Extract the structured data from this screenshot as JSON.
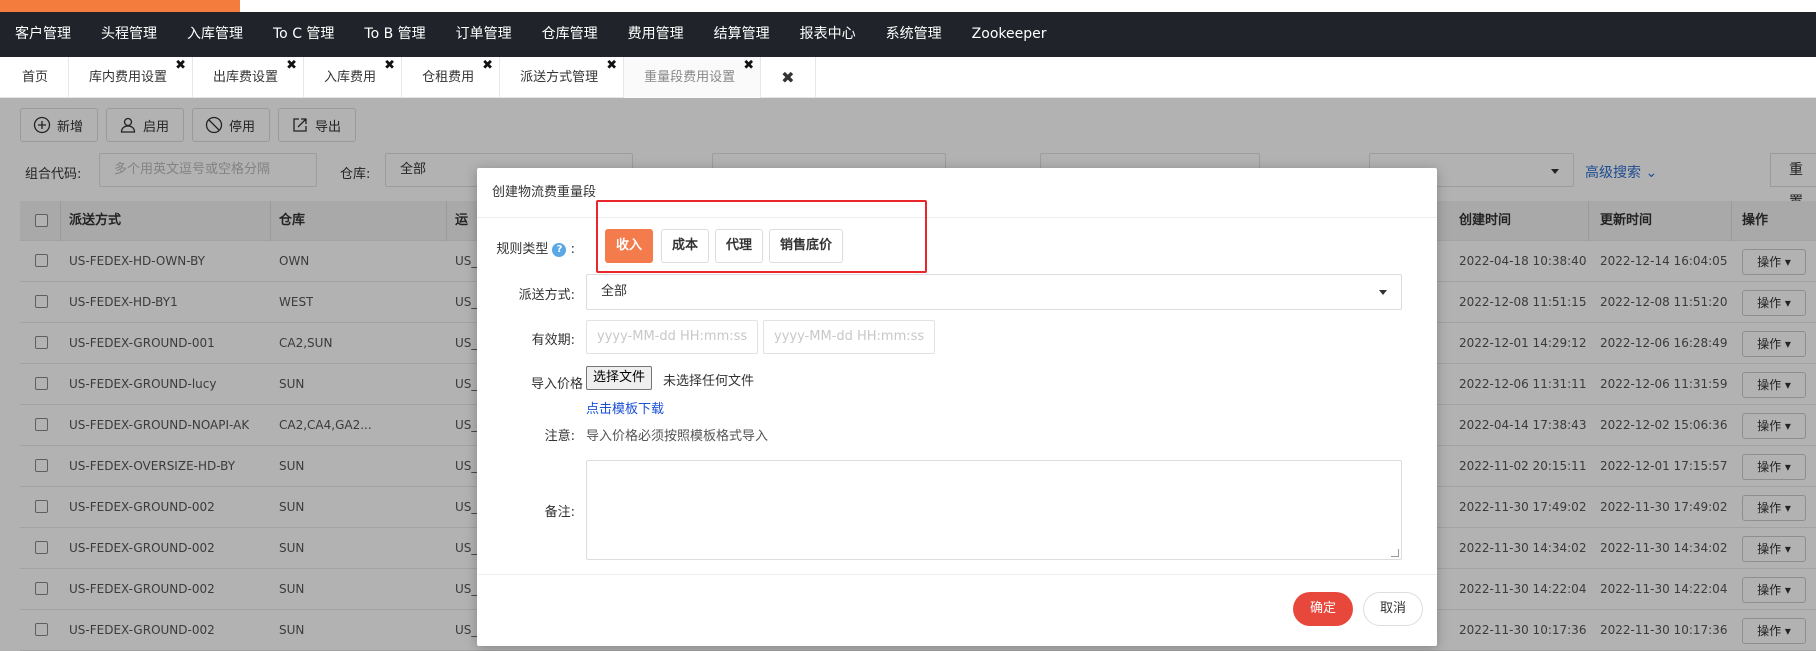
{
  "nav": [
    "客户管理",
    "头程管理",
    "入库管理",
    "To C 管理",
    "To B 管理",
    "订单管理",
    "仓库管理",
    "费用管理",
    "结算管理",
    "报表中心",
    "系统管理",
    "Zookeeper"
  ],
  "tabs": [
    "首页",
    "库内费用设置",
    "出库费设置",
    "入库费用",
    "仓租费用",
    "派送方式管理",
    "重量段费用设置"
  ],
  "tab_close_glyph": "✖",
  "toolbar": {
    "add": "新增",
    "enable": "启用",
    "disable": "停用",
    "export": "导出"
  },
  "filters": {
    "combo_label": "组合代码:",
    "combo_placeholder": "多个用英文逗号或空格分隔",
    "warehouse_label": "仓库:",
    "warehouse_value": "全部",
    "advanced": "高级搜索",
    "reset": "重置"
  },
  "table": {
    "headers": {
      "method": "派送方式",
      "warehouse": "仓库",
      "third": "运",
      "created": "创建时间",
      "updated": "更新时间",
      "op": "操作"
    },
    "op_label": "操作",
    "rows": [
      {
        "method": "US-FEDEX-HD-OWN-BY",
        "warehouse": "OWN",
        "third": "US_",
        "created": "2022-04-18 10:38:40",
        "updated": "2022-12-14 16:04:05"
      },
      {
        "method": "US-FEDEX-HD-BY1",
        "warehouse": "WEST",
        "third": "US_",
        "created": "2022-12-08 11:51:15",
        "updated": "2022-12-08 11:51:20"
      },
      {
        "method": "US-FEDEX-GROUND-001",
        "warehouse": "CA2,SUN",
        "third": "US_",
        "created": "2022-12-01 14:29:12",
        "updated": "2022-12-06 16:28:49"
      },
      {
        "method": "US-FEDEX-GROUND-lucy",
        "warehouse": "SUN",
        "third": "US_",
        "created": "2022-12-06 11:31:11",
        "updated": "2022-12-06 11:31:59"
      },
      {
        "method": "US-FEDEX-GROUND-NOAPI-AK",
        "warehouse": "CA2,CA4,GA2...",
        "third": "US_",
        "created": "2022-04-14 17:38:43",
        "updated": "2022-12-02 15:06:36"
      },
      {
        "method": "US-FEDEX-OVERSIZE-HD-BY",
        "warehouse": "SUN",
        "third": "US_",
        "created": "2022-11-02 20:15:11",
        "updated": "2022-12-01 17:15:57"
      },
      {
        "method": "US-FEDEX-GROUND-002",
        "warehouse": "SUN",
        "third": "US_",
        "created": "2022-11-30 17:49:02",
        "updated": "2022-11-30 17:49:02"
      },
      {
        "method": "US-FEDEX-GROUND-002",
        "warehouse": "SUN",
        "third": "US_",
        "created": "2022-11-30 14:34:02",
        "updated": "2022-11-30 14:34:02"
      },
      {
        "method": "US-FEDEX-GROUND-002",
        "warehouse": "SUN",
        "third": "US_",
        "created": "2022-11-30 14:22:04",
        "updated": "2022-11-30 14:22:04"
      },
      {
        "method": "US-FEDEX-GROUND-002",
        "warehouse": "SUN",
        "third": "US_",
        "created": "2022-11-30 10:17:36",
        "updated": "2022-11-30 10:17:36"
      }
    ]
  },
  "modal": {
    "title": "创建物流费重量段",
    "rule_type_label": "规则类型",
    "rule_types": [
      "收入",
      "成本",
      "代理",
      "销售底价"
    ],
    "active_rule": "收入",
    "delivery_label": "派送方式:",
    "delivery_value": "全部",
    "validity_label": "有效期:",
    "date_placeholder": "yyyy-MM-dd HH:mm:ss",
    "import_label": "导入价格",
    "file_button": "选择文件",
    "file_status": "未选择任何文件",
    "template_link": "点击模板下载",
    "note_label": "注意:",
    "note_text": "导入价格必须按照模板格式导入",
    "remark_label": "备注:",
    "ok": "确定",
    "cancel": "取消"
  },
  "colors": {
    "accent": "#f47c4c",
    "nav_bg": "#20242a",
    "ok": "#e8483c",
    "highlight_box": "#e8262b"
  }
}
